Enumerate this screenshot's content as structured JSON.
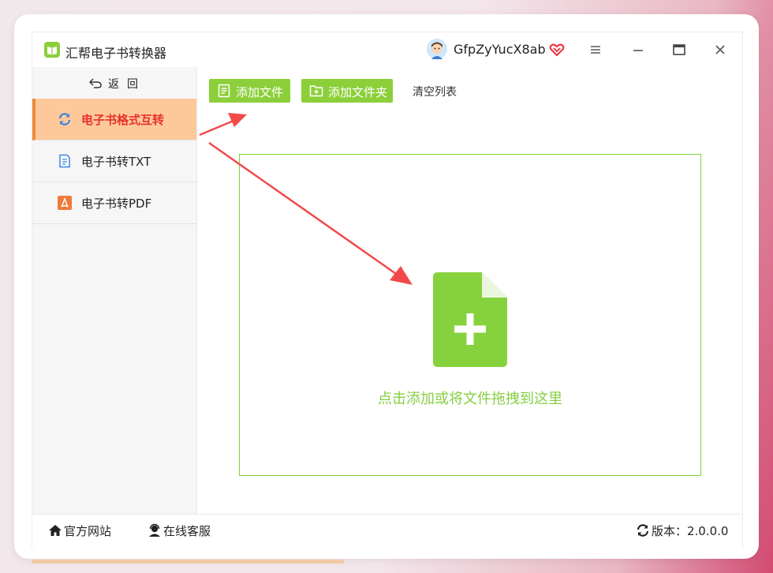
{
  "app": {
    "title": "汇帮电子书转换器",
    "username": "GfpZyYucX8ab"
  },
  "sidebar": {
    "back_label": "返回",
    "items": [
      {
        "label": "电子书格式互转",
        "icon": "refresh-icon",
        "active": true
      },
      {
        "label": "电子书转TXT",
        "icon": "document-icon",
        "active": false
      },
      {
        "label": "电子书转PDF",
        "icon": "pdf-icon",
        "active": false
      }
    ]
  },
  "toolbar": {
    "add_file_label": "添加文件",
    "add_folder_label": "添加文件夹",
    "clear_label": "清空列表"
  },
  "dropzone": {
    "text": "点击添加或将文件拖拽到这里",
    "icon": "add-file-icon"
  },
  "footer": {
    "site_label": "官方网站",
    "service_label": "在线客服",
    "version_label": "版本：2.0.0.0"
  },
  "colors": {
    "accent_green": "#8ccf3b",
    "active_bg": "#fdc99a",
    "active_text": "#e8312a",
    "arrow_red": "#f24a4a"
  }
}
